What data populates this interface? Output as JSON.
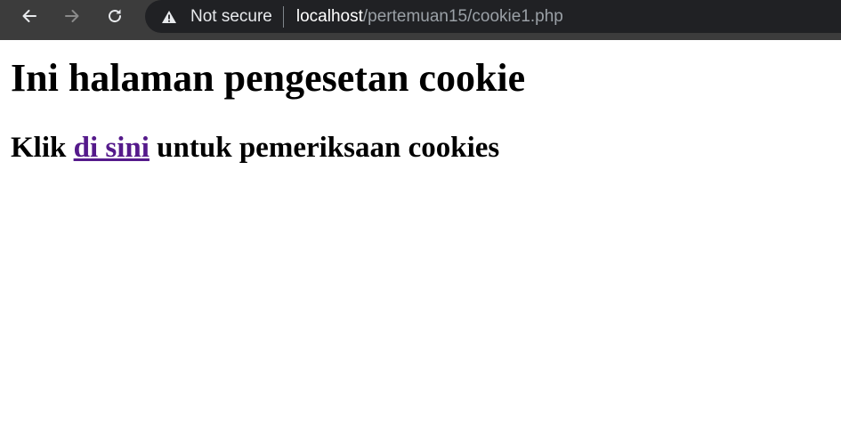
{
  "browser": {
    "nav_icons": [
      "back-arrow-icon",
      "forward-arrow-icon",
      "reload-icon"
    ],
    "security_icon": "warning-triangle-icon",
    "security_label": "Not secure",
    "url_host": "localhost",
    "url_path": "/pertemuan15/cookie1.php"
  },
  "page": {
    "heading": "Ini halaman pengesetan cookie",
    "instruction_prefix": "Klik",
    "link_text": "di sini",
    "instruction_suffix": "untuk pemeriksaan cookies"
  },
  "colors": {
    "toolbar": "#3c3c3c",
    "omnibox": "#202124",
    "visited_link": "#551a8b"
  }
}
